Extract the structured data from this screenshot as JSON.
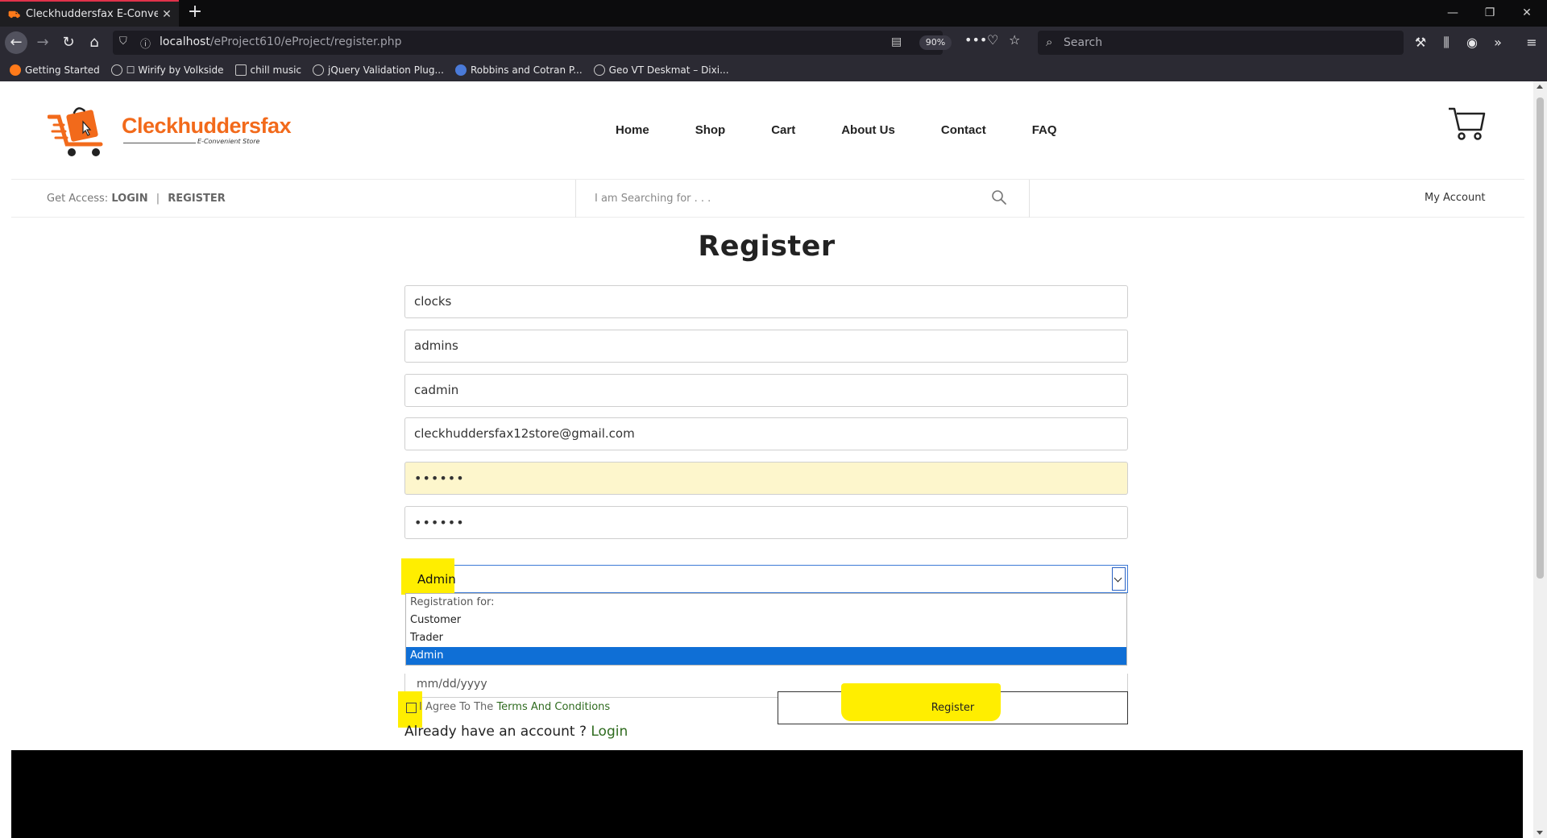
{
  "browser": {
    "tab_title": "Cleckhuddersfax E-Convenient",
    "url_host": "localhost",
    "url_path": "/eProject610/eProject/register.php",
    "zoom": "90%",
    "search_placeholder": "Search",
    "bookmarks": [
      {
        "label": "Getting Started",
        "icon": "firefox-icon"
      },
      {
        "label": "☐ Wirify by Volkside",
        "icon": "globe-icon"
      },
      {
        "label": "chill music",
        "icon": "folder-icon"
      },
      {
        "label": "jQuery Validation Plug...",
        "icon": "globe-icon"
      },
      {
        "label": "Robbins and Cotran P...",
        "icon": "site-icon"
      },
      {
        "label": "Geo VT Deskmat – Dixi...",
        "icon": "globe-icon"
      }
    ]
  },
  "site": {
    "logo_name": "Cleckhuddersfax",
    "logo_tagline": "E-Convenient Store",
    "brand_color": "#f26a1b",
    "nav": [
      "Home",
      "Shop",
      "Cart",
      "About Us",
      "Contact",
      "FAQ"
    ],
    "access_label": "Get Access:",
    "login_label": "LOGIN",
    "separator": "|",
    "register_label": "REGISTER",
    "search_placeholder": "I am Searching for . . .",
    "my_account": "My Account"
  },
  "form": {
    "title": "Register",
    "first_name": "clocks",
    "last_name": "admins",
    "username": "cadmin",
    "email": "cleckhuddersfax12store@gmail.com",
    "password": "••••••",
    "confirm_password": "••••••",
    "role_selected": "Admin",
    "role_options": [
      "Registration for:",
      "Customer",
      "Trader",
      "Admin"
    ],
    "dob_placeholder": "mm/dd/yyyy",
    "terms_prefix": "I Agree To The",
    "terms_link": "Terms And Conditions",
    "register_button": "Register",
    "already_text": "Already have an account ?",
    "login_link": "Login",
    "highlight_color": "#ffee00"
  }
}
